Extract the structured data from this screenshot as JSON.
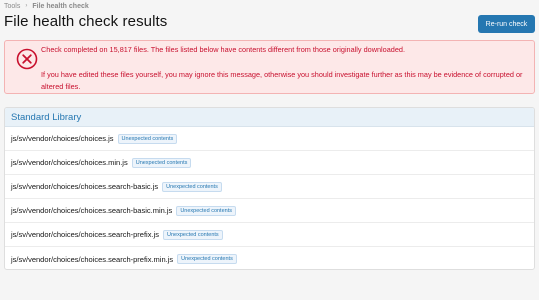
{
  "breadcrumb": {
    "parent": "Tools",
    "separator": "›",
    "current": "File health check"
  },
  "page": {
    "title": "File health check results"
  },
  "toolbar": {
    "rerun_label": "Re-run check"
  },
  "alert": {
    "line1": "Check completed on 15,817 files. The files listed below have contents different from those originally downloaded.",
    "line2": "If you have edited these files yourself, you may ignore this message, otherwise you should investigate further as this may be evidence of corrupted or altered files.",
    "icon": "error-circle-x-icon",
    "color": "#c8102e"
  },
  "panel": {
    "title": "Standard Library",
    "rows": [
      {
        "path": "js/sv/vendor/choices/choices.js",
        "status": "Unexpected contents"
      },
      {
        "path": "js/sv/vendor/choices/choices.min.js",
        "status": "Unexpected contents"
      },
      {
        "path": "js/sv/vendor/choices/choices.search-basic.js",
        "status": "Unexpected contents"
      },
      {
        "path": "js/sv/vendor/choices/choices.search-basic.min.js",
        "status": "Unexpected contents"
      },
      {
        "path": "js/sv/vendor/choices/choices.search-prefix.js",
        "status": "Unexpected contents"
      },
      {
        "path": "js/sv/vendor/choices/choices.search-prefix.min.js",
        "status": "Unexpected contents"
      }
    ]
  },
  "colors": {
    "accent": "#2577b1",
    "error": "#c8102e",
    "error_bg": "#fde8e8"
  }
}
